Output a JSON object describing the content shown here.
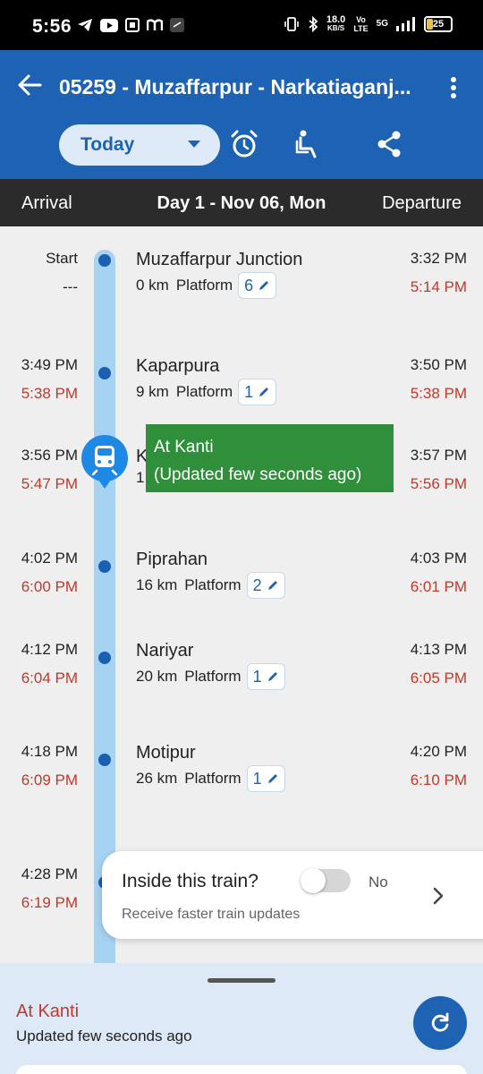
{
  "status_bar": {
    "time": "5:56",
    "net_speed_value": "18.0",
    "net_speed_unit": "KB/S",
    "network": "5G",
    "battery": "25"
  },
  "header": {
    "title": "05259 - Muzaffarpur - Narkatiaganj...",
    "date_selected": "Today",
    "accent_color": "#1e63b3"
  },
  "day_bar": {
    "arrival_label": "Arrival",
    "day_label": "Day 1 - Nov 06, Mon",
    "departure_label": "Departure"
  },
  "stations": [
    {
      "arr_sched": "Start",
      "arr_actual": "---",
      "name": "Muzaffarpur Junction",
      "km": "0 km",
      "platform_label": "Platform",
      "platform": "6",
      "dep_sched": "3:32 PM",
      "dep_actual": "5:14 PM"
    },
    {
      "arr_sched": "3:49 PM",
      "arr_actual": "5:38 PM",
      "name": "Kaparpura",
      "km": "9 km",
      "platform_label": "Platform",
      "platform": "1",
      "dep_sched": "3:50 PM",
      "dep_actual": "5:38 PM"
    },
    {
      "arr_sched": "3:56 PM",
      "arr_actual": "5:47 PM",
      "name": "K",
      "km": "1",
      "platform_label": "",
      "platform": "",
      "dep_sched": "3:57 PM",
      "dep_actual": "5:56 PM"
    },
    {
      "arr_sched": "4:02 PM",
      "arr_actual": "6:00 PM",
      "name": "Piprahan",
      "km": "16 km",
      "platform_label": "Platform",
      "platform": "2",
      "dep_sched": "4:03 PM",
      "dep_actual": "6:01 PM"
    },
    {
      "arr_sched": "4:12 PM",
      "arr_actual": "6:04 PM",
      "name": "Nariyar",
      "km": "20 km",
      "platform_label": "Platform",
      "platform": "1",
      "dep_sched": "4:13 PM",
      "dep_actual": "6:05 PM"
    },
    {
      "arr_sched": "4:18 PM",
      "arr_actual": "6:09 PM",
      "name": "Motipur",
      "km": "26 km",
      "platform_label": "Platform",
      "platform": "1",
      "dep_sched": "4:20 PM",
      "dep_actual": "6:10 PM"
    },
    {
      "arr_sched": "4:28 PM",
      "arr_actual": "6:19 PM",
      "name": "",
      "km": "",
      "platform_label": "",
      "platform": "",
      "dep_sched": "",
      "dep_actual": ""
    }
  ],
  "live_status": {
    "line1": "At Kanti",
    "line2": "(Updated few seconds ago)"
  },
  "inside_train": {
    "question": "Inside this train?",
    "toggle_label": "No",
    "subtitle": "Receive faster train updates"
  },
  "bottom_sheet": {
    "status": "At Kanti",
    "updated": "Updated few seconds ago"
  }
}
